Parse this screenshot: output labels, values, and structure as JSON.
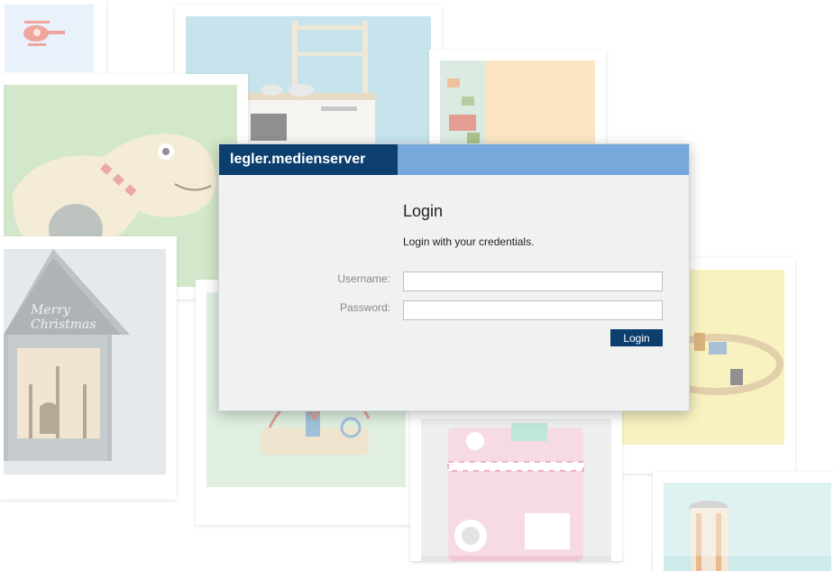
{
  "header": {
    "brand": "legler.medienserver"
  },
  "login": {
    "title": "Login",
    "subtitle": "Login with your credentials.",
    "username_label": "Username:",
    "password_label": "Password:",
    "username_value": "",
    "password_value": "",
    "submit_label": "Login"
  },
  "background_photos": {
    "card_christmas_house": {
      "text": "Merry Christmas"
    }
  },
  "colors": {
    "brand_dark": "#0d3f6e",
    "header_bar": "#77a8dc",
    "dialog_bg": "#f0f2f2"
  }
}
